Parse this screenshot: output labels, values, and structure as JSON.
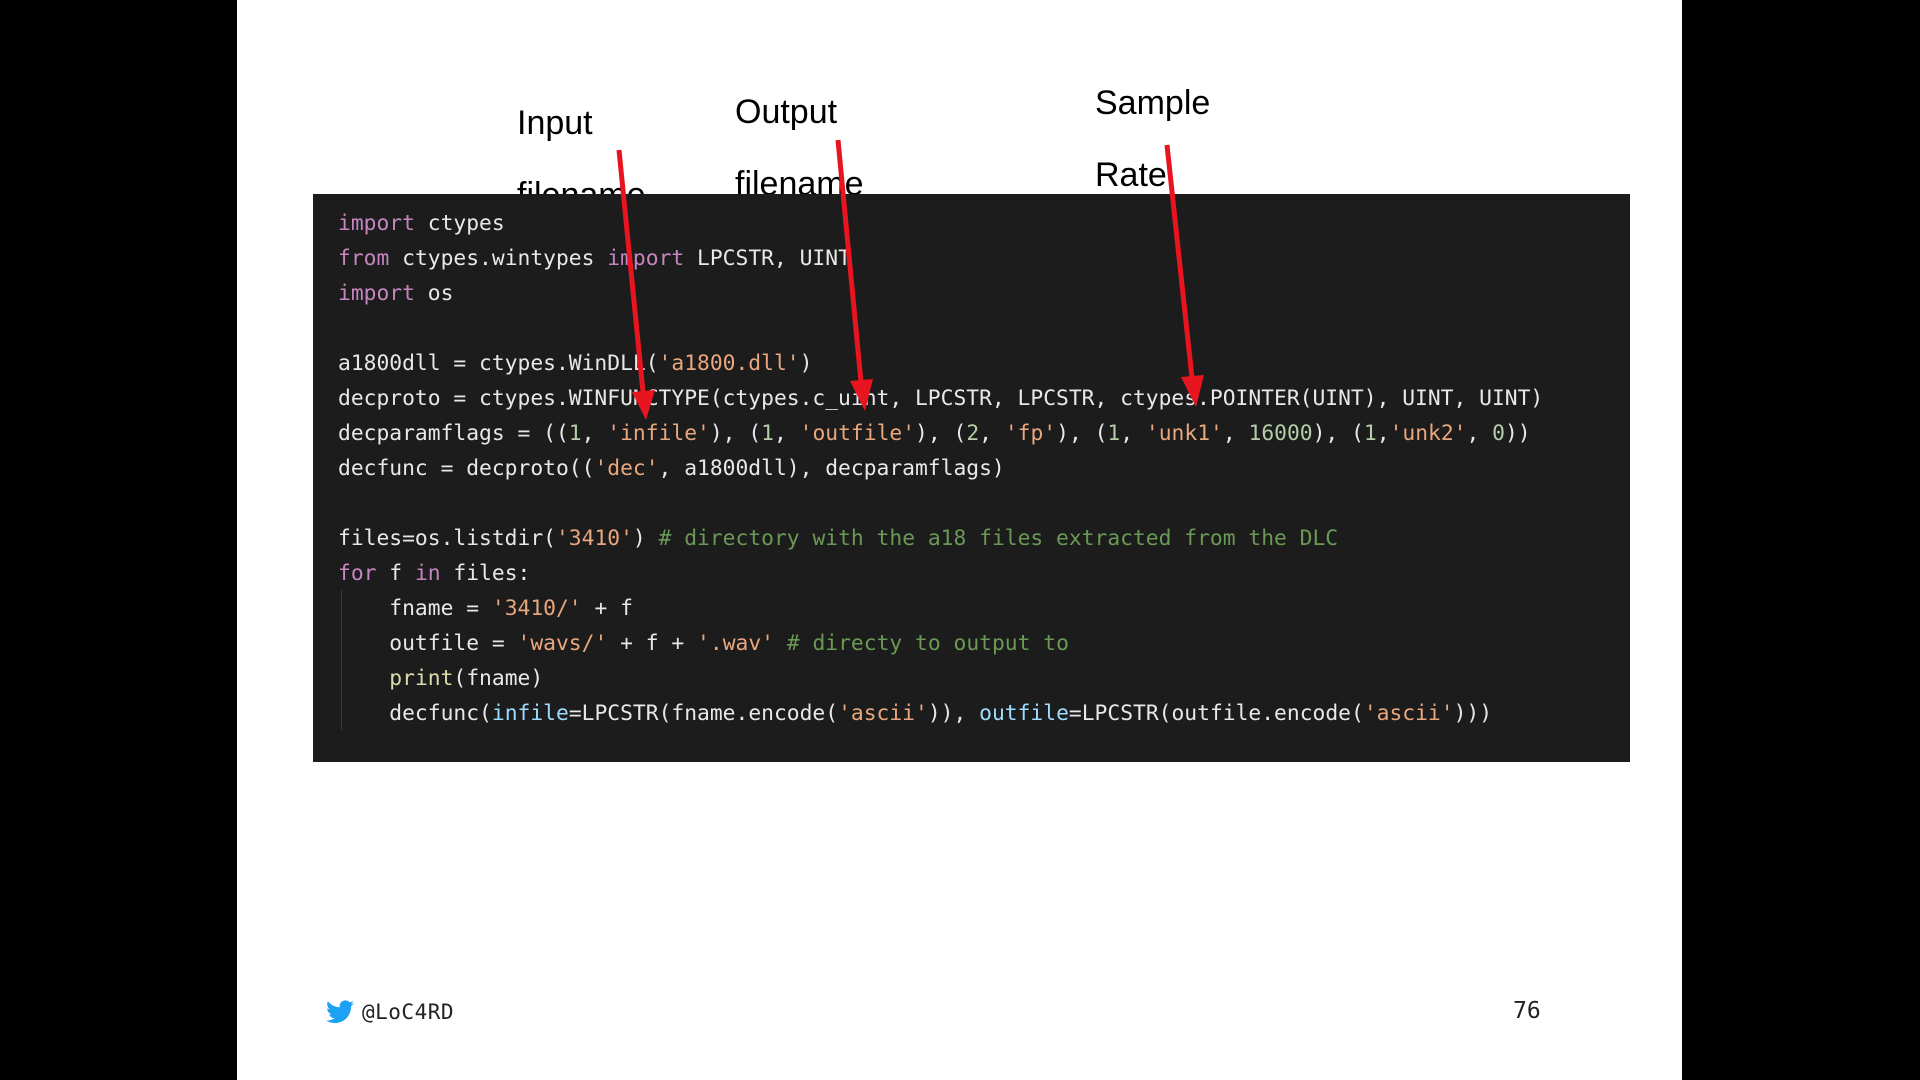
{
  "slide": {
    "labels": {
      "input": [
        "Input",
        "filename"
      ],
      "output": [
        "Output",
        "filename"
      ],
      "sample": [
        "Sample",
        "Rate"
      ]
    },
    "footer": {
      "handle": "@LoC4RD",
      "page_number": "76",
      "icon": "twitter-bird-icon"
    }
  },
  "code": {
    "lines": [
      [
        {
          "t": "import",
          "c": "kw"
        },
        {
          "t": " ctypes"
        }
      ],
      [
        {
          "t": "from",
          "c": "kw"
        },
        {
          "t": " ctypes.wintypes "
        },
        {
          "t": "import",
          "c": "kw"
        },
        {
          "t": " LPCSTR, UINT"
        }
      ],
      [
        {
          "t": "import",
          "c": "kw"
        },
        {
          "t": " os"
        }
      ],
      [],
      [
        {
          "t": "a1800dll = ctypes.WinDLL("
        },
        {
          "t": "'a1800.dll'",
          "c": "str"
        },
        {
          "t": ")"
        }
      ],
      [
        {
          "t": "decproto = ctypes.WINFUNCTYPE(ctypes.c_uint, LPCSTR, LPCSTR, ctypes.POINTER(UINT), UINT, UINT)"
        }
      ],
      [
        {
          "t": "decparamflags = (("
        },
        {
          "t": "1",
          "c": "num"
        },
        {
          "t": ", "
        },
        {
          "t": "'infile'",
          "c": "str"
        },
        {
          "t": "), ("
        },
        {
          "t": "1",
          "c": "num"
        },
        {
          "t": ", "
        },
        {
          "t": "'outfile'",
          "c": "str"
        },
        {
          "t": "), ("
        },
        {
          "t": "2",
          "c": "num"
        },
        {
          "t": ", "
        },
        {
          "t": "'fp'",
          "c": "str"
        },
        {
          "t": "), ("
        },
        {
          "t": "1",
          "c": "num"
        },
        {
          "t": ", "
        },
        {
          "t": "'unk1'",
          "c": "str"
        },
        {
          "t": ", "
        },
        {
          "t": "16000",
          "c": "num"
        },
        {
          "t": "), ("
        },
        {
          "t": "1",
          "c": "num"
        },
        {
          "t": ","
        },
        {
          "t": "'unk2'",
          "c": "str"
        },
        {
          "t": ", "
        },
        {
          "t": "0",
          "c": "num"
        },
        {
          "t": "))"
        }
      ],
      [
        {
          "t": "decfunc = decproto(("
        },
        {
          "t": "'dec'",
          "c": "str"
        },
        {
          "t": ", a1800dll), decparamflags)"
        }
      ],
      [],
      [
        {
          "t": "files=os.listdir("
        },
        {
          "t": "'3410'",
          "c": "str"
        },
        {
          "t": ") "
        },
        {
          "t": "# directory with the a18 files extracted from the DLC",
          "c": "cm"
        }
      ],
      [
        {
          "t": "for",
          "c": "kw"
        },
        {
          "t": " f "
        },
        {
          "t": "in",
          "c": "kw"
        },
        {
          "t": " files:"
        }
      ],
      [
        {
          "t": "    fname = "
        },
        {
          "t": "'3410/'",
          "c": "str"
        },
        {
          "t": " + f"
        }
      ],
      [
        {
          "t": "    outfile = "
        },
        {
          "t": "'wavs/'",
          "c": "str"
        },
        {
          "t": " + f + "
        },
        {
          "t": "'.wav'",
          "c": "str"
        },
        {
          "t": " "
        },
        {
          "t": "# directy to output to",
          "c": "cm"
        }
      ],
      [
        {
          "t": "    "
        },
        {
          "t": "print",
          "c": "fn"
        },
        {
          "t": "(fname)"
        }
      ],
      [
        {
          "t": "    decfunc("
        },
        {
          "t": "infile",
          "c": "param"
        },
        {
          "t": "=LPCSTR(fname.encode("
        },
        {
          "t": "'ascii'",
          "c": "str"
        },
        {
          "t": ")), "
        },
        {
          "t": "outfile",
          "c": "param"
        },
        {
          "t": "=LPCSTR(outfile.encode("
        },
        {
          "t": "'ascii'",
          "c": "str"
        },
        {
          "t": ")))"
        }
      ]
    ]
  },
  "colors": {
    "arrow": "#e8141f",
    "code_background": "#1c1c1c",
    "twitter_blue": "#1da1f2"
  }
}
